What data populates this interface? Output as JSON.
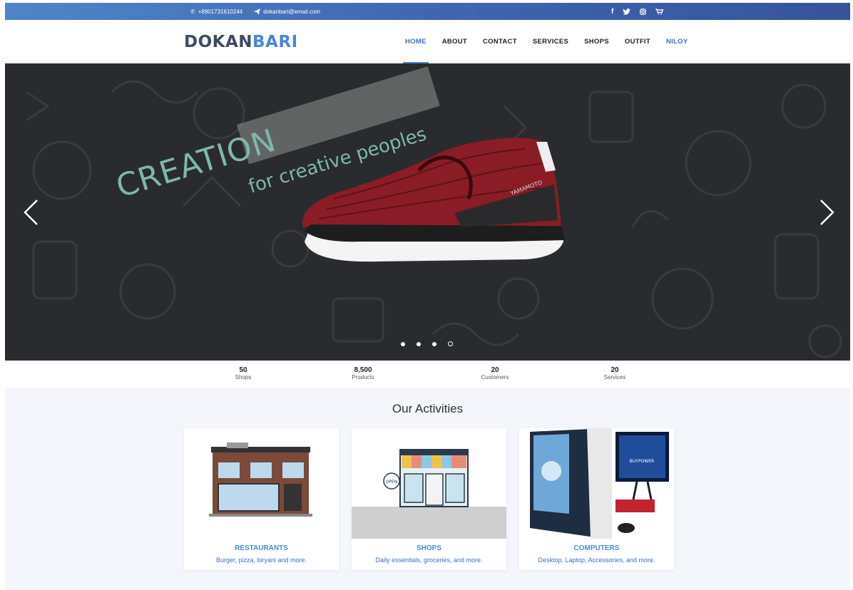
{
  "topbar": {
    "phone": "+8801731610244",
    "email": "dokanbari@email.com",
    "icons": [
      "phone-icon",
      "send-icon",
      "facebook-icon",
      "twitter-icon",
      "instagram-icon",
      "cart-icon"
    ]
  },
  "nav": {
    "logo_part1": "dokan",
    "logo_part2": "bari",
    "items": [
      "HOME",
      "ABOUT",
      "CONTACT",
      "SERVICES",
      "SHOPS",
      "OUTFIT",
      "NILOY"
    ],
    "active": "HOME"
  },
  "hero": {
    "headline": "CREATION",
    "tagline": "for creative peoples",
    "shoe_brand": "YAMAMOTO",
    "slide_count": 4,
    "active_slide": 4
  },
  "stats": [
    {
      "value": "50",
      "label": "Shops"
    },
    {
      "value": "8,500",
      "label": "Products"
    },
    {
      "value": "20",
      "label": "Customers"
    },
    {
      "value": "20",
      "label": "Services"
    }
  ],
  "activities": {
    "heading": "Our Activities",
    "cards": [
      {
        "title": "RESTAURANTS",
        "desc": "Burger, pizza, biryani and more."
      },
      {
        "title": "SHOPS",
        "desc": "Daily essentials, groceries, and more."
      },
      {
        "title": "COMPUTERS",
        "desc": "Desktop, Laptop, Accessories, and more."
      }
    ],
    "shop_sign": "OPEN",
    "monitor_brand": "BUYPOWER"
  },
  "colors": {
    "accent": "#4a86d6",
    "topbar": "#3f67b0",
    "hero_bg": "#2a2b2e",
    "headline": "#7fb7a8"
  }
}
